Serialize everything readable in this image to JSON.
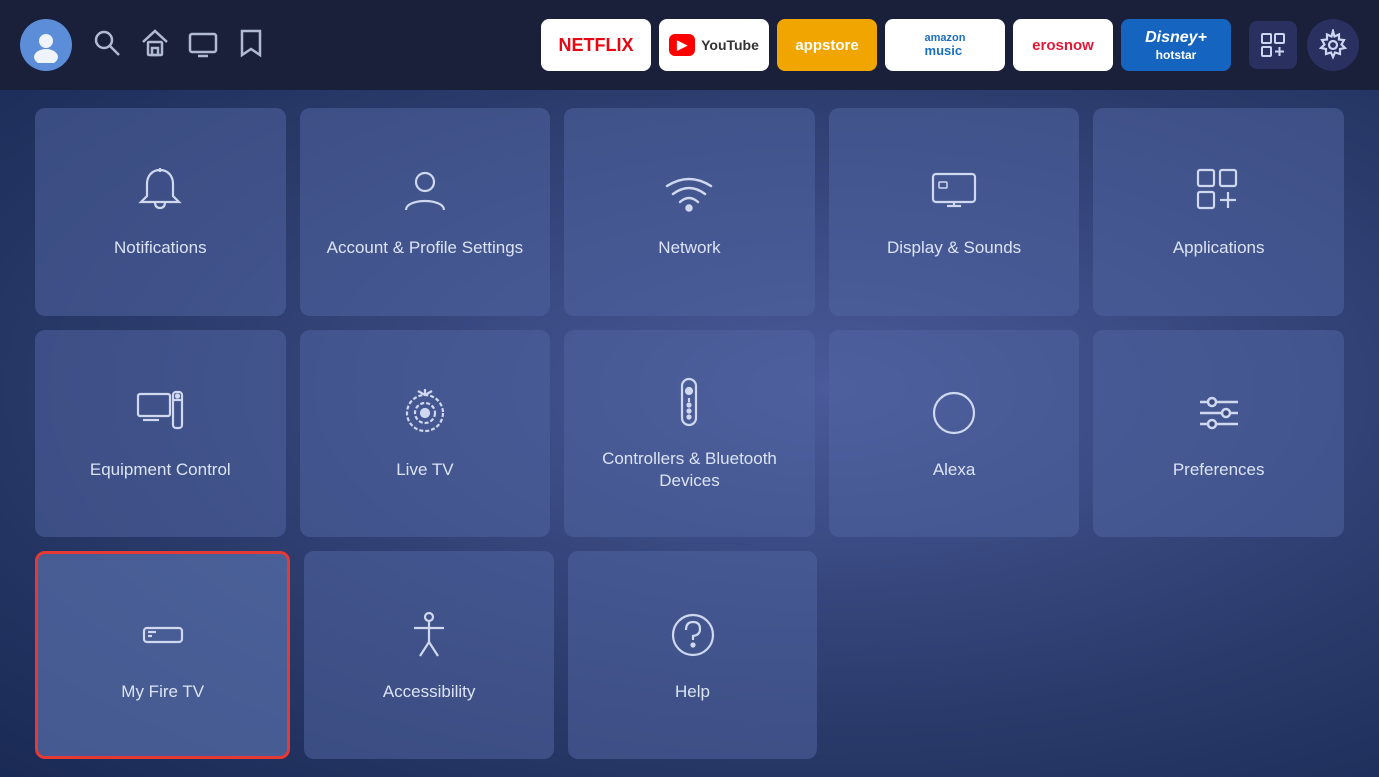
{
  "nav": {
    "avatar_label": "User Avatar",
    "search_label": "Search",
    "home_label": "Home",
    "tv_label": "TV/Live",
    "watchlist_label": "Watchlist"
  },
  "apps": [
    {
      "id": "netflix",
      "label": "NETFLIX"
    },
    {
      "id": "youtube",
      "label": "YouTube"
    },
    {
      "id": "appstore",
      "label": "appstore"
    },
    {
      "id": "amazon-music",
      "label": "amazon music"
    },
    {
      "id": "erosnow",
      "label": "erosnow"
    },
    {
      "id": "hotstar",
      "label": "Disney+ Hotstar"
    }
  ],
  "top_right": [
    {
      "id": "grid-icon",
      "label": "Grid View"
    },
    {
      "id": "settings-icon",
      "label": "Settings"
    }
  ],
  "grid": {
    "rows": [
      [
        {
          "id": "notifications",
          "label": "Notifications",
          "icon": "bell"
        },
        {
          "id": "account-profile",
          "label": "Account & Profile Settings",
          "icon": "person"
        },
        {
          "id": "network",
          "label": "Network",
          "icon": "wifi"
        },
        {
          "id": "display-sounds",
          "label": "Display & Sounds",
          "icon": "display"
        },
        {
          "id": "applications",
          "label": "Applications",
          "icon": "grid-apps"
        }
      ],
      [
        {
          "id": "equipment-control",
          "label": "Equipment Control",
          "icon": "monitor"
        },
        {
          "id": "live-tv",
          "label": "Live TV",
          "icon": "antenna"
        },
        {
          "id": "controllers-bluetooth",
          "label": "Controllers & Bluetooth Devices",
          "icon": "remote"
        },
        {
          "id": "alexa",
          "label": "Alexa",
          "icon": "alexa"
        },
        {
          "id": "preferences",
          "label": "Preferences",
          "icon": "sliders"
        }
      ],
      [
        {
          "id": "my-fire-tv",
          "label": "My Fire TV",
          "icon": "firetv",
          "selected": true
        },
        {
          "id": "accessibility",
          "label": "Accessibility",
          "icon": "accessibility"
        },
        {
          "id": "help",
          "label": "Help",
          "icon": "help"
        },
        null,
        null
      ]
    ]
  }
}
